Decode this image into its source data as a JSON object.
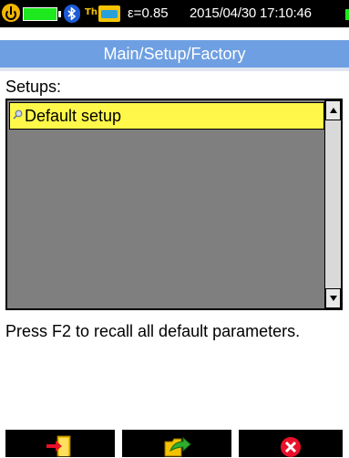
{
  "status_bar": {
    "emissivity": "ε=0.85",
    "datetime": "2015/04/30 17:10:46",
    "thermo_label": "Th",
    "icons": [
      "power-icon",
      "battery-icon",
      "bluetooth-icon",
      "sd-card-icon"
    ]
  },
  "title": "Main/Setup/Factory",
  "setups": {
    "label": "Setups:",
    "items": [
      {
        "label": "Default setup",
        "selected": true,
        "icon": "magnifier-icon"
      }
    ]
  },
  "message": "Press F2 to recall all default parameters.",
  "function_keys": [
    {
      "name": "f1",
      "icon": "exit-icon"
    },
    {
      "name": "f2",
      "icon": "recall-icon"
    },
    {
      "name": "f3",
      "icon": "cancel-icon"
    }
  ],
  "colors": {
    "title_bar": "#6e9fe2",
    "selection": "#fff84a",
    "list_background": "#7f7f7f",
    "battery": "#1ee81e",
    "cancel": "#e8102a"
  }
}
